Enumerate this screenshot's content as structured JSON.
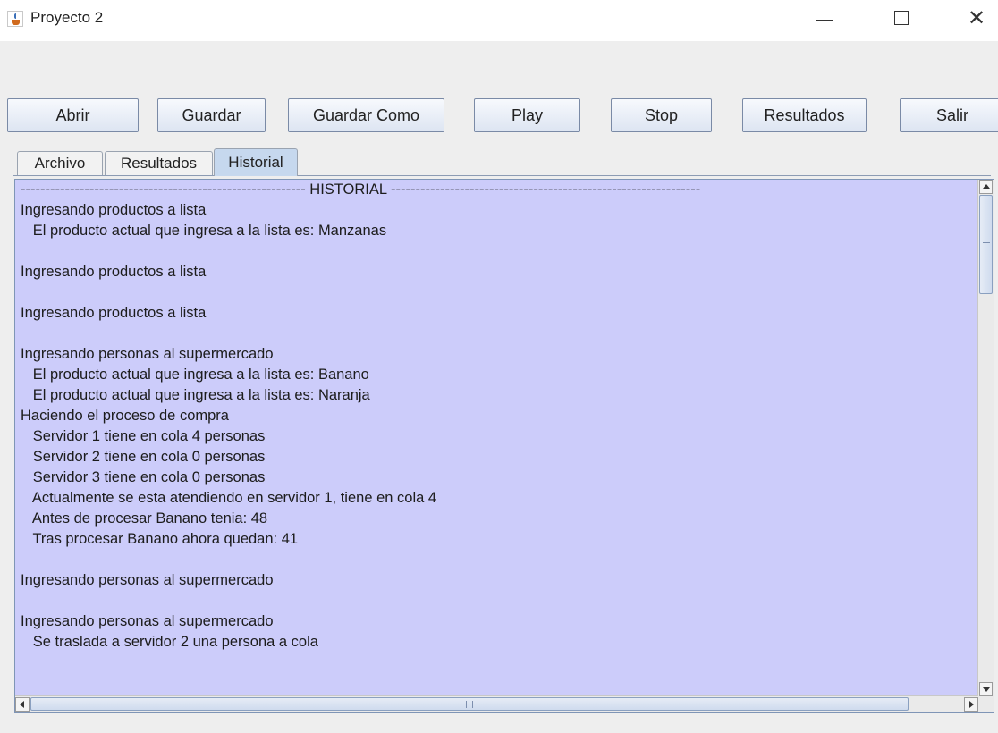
{
  "window": {
    "title": "Proyecto 2",
    "minimize_label": "—",
    "maximize_label": "☐",
    "close_label": "✕"
  },
  "toolbar": {
    "abrir": "Abrir",
    "guardar": "Guardar",
    "guardar_como": "Guardar Como",
    "play": "Play",
    "stop": "Stop",
    "resultados": "Resultados",
    "salir": "Salir"
  },
  "tabs": [
    {
      "label": "Archivo",
      "selected": false
    },
    {
      "label": "Resultados",
      "selected": false
    },
    {
      "label": "Historial",
      "selected": true
    }
  ],
  "historial": {
    "lines": [
      "---------------------------------------------------------- HISTORIAL ---------------------------------------------------------------",
      "Ingresando productos a lista",
      "   El producto actual que ingresa a la lista es: Manzanas",
      "",
      "Ingresando productos a lista",
      "",
      "Ingresando productos a lista",
      "",
      "Ingresando personas al supermercado",
      "   El producto actual que ingresa a la lista es: Banano",
      "   El producto actual que ingresa a la lista es: Naranja",
      "Haciendo el proceso de compra",
      "   Servidor 1 tiene en cola 4 personas",
      "   Servidor 2 tiene en cola 0 personas",
      "   Servidor 3 tiene en cola 0 personas",
      "   Actualmente se esta atendiendo en servidor 1, tiene en cola 4",
      "   Antes de procesar Banano tenia: 48",
      "   Tras procesar Banano ahora quedan: 41",
      "",
      "Ingresando personas al supermercado",
      "",
      "Ingresando personas al supermercado",
      "   Se traslada a servidor 2 una persona a cola"
    ]
  },
  "colors": {
    "text_area_background": "#ccccfa",
    "selected_tab": "#c6d8ee",
    "window_background": "#eeeeee"
  }
}
